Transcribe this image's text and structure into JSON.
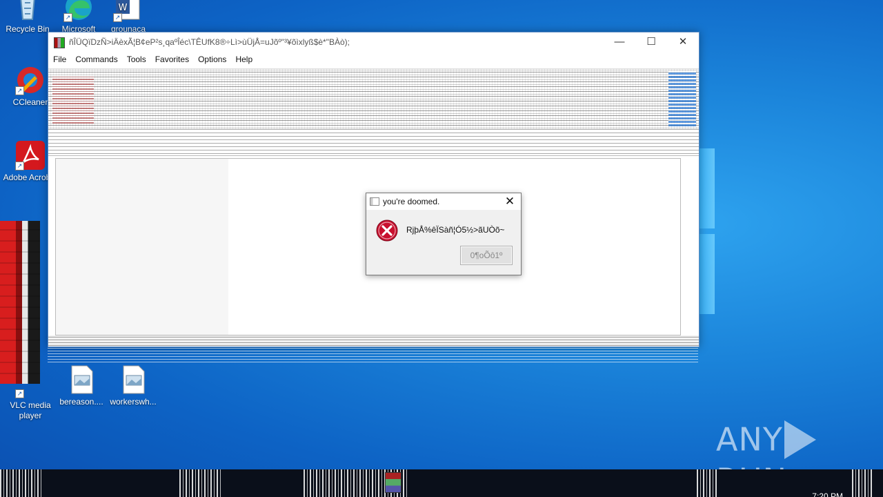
{
  "desktop": {
    "icons": [
      {
        "label": "Recycle Bin"
      },
      {
        "label": "Microsoft"
      },
      {
        "label": "grounaca"
      },
      {
        "label": "CCleaner"
      },
      {
        "label": "Adobe Acrobat"
      },
      {
        "label": "VLC media player"
      },
      {
        "label": "bereason...."
      },
      {
        "label": "workerswh..."
      }
    ],
    "watermark_left": "ANY",
    "watermark_right": "RUN"
  },
  "main_window": {
    "title": "ñÎÜQïDzÑ>iÄèxÃ¦B¢eP²s¸qaºÎéc\\TÊUfK8®÷Lì>ùÜjÅ=uJõº\"³¥õìxlyß$è*\"BÀò);",
    "caption": {
      "minimize": "—",
      "maximize": "☐",
      "close": "✕"
    },
    "menu": [
      "File",
      "Commands",
      "Tools",
      "Favorites",
      "Options",
      "Help"
    ]
  },
  "dialog": {
    "title": "you're doomed.",
    "close": "✕",
    "message": "RjþÅ%êÏSàñ¦Ó5½>ãUÒõ~",
    "button": "0¶oÕô1º"
  },
  "taskbar": {
    "clock": "7:20 PM"
  },
  "colors": {
    "desktop_blue": "#1b84da",
    "error_red": "#c8102e"
  }
}
